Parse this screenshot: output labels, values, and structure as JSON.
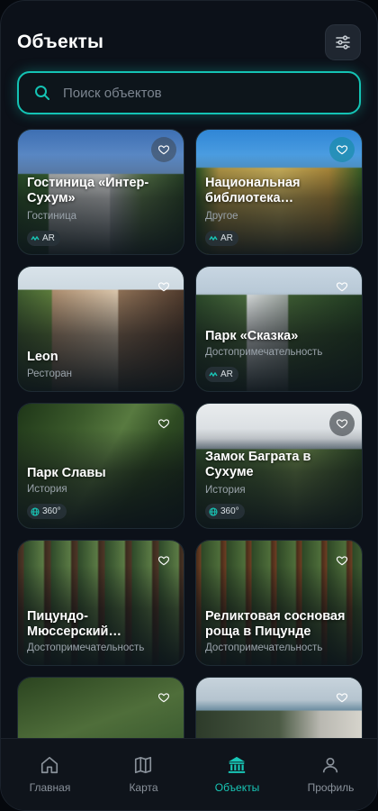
{
  "header": {
    "title": "Объекты",
    "filter_icon": "sliders-icon"
  },
  "search": {
    "placeholder": "Поиск объектов",
    "value": "",
    "icon": "search-icon"
  },
  "cards": [
    {
      "name": "Гостиница «Интер-Сухум»",
      "category": "Гостиница",
      "badge": "AR",
      "badge_icon": "ar-icon",
      "favorite": false
    },
    {
      "name": "Национальная библиотека…",
      "category": "Другое",
      "badge": "AR",
      "badge_icon": "ar-icon",
      "favorite": true
    },
    {
      "name": "Leon",
      "category": "Ресторан",
      "badge": "",
      "favorite": false
    },
    {
      "name": "Парк «Сказка»",
      "category": "Достопримечательность",
      "badge": "AR",
      "badge_icon": "ar-icon",
      "favorite": false
    },
    {
      "name": "Парк Славы",
      "category": "История",
      "badge": "360°",
      "badge_icon": "globe-icon",
      "favorite": false
    },
    {
      "name": "Замок Баграта в Сухуме",
      "category": "История",
      "badge": "360°",
      "badge_icon": "globe-icon",
      "favorite": true
    },
    {
      "name": "Пицундо-Мюссерский…",
      "category": "Достопримечательность",
      "badge": "",
      "favorite": false
    },
    {
      "name": "Реликтовая сосновая роща в Пицунде",
      "category": "Достопримечательность",
      "badge": "",
      "favorite": false
    },
    {
      "name": "",
      "category": "",
      "badge": "",
      "favorite": false
    },
    {
      "name": "",
      "category": "",
      "badge": "",
      "favorite": false
    }
  ],
  "nav": [
    {
      "label": "Главная",
      "icon": "home-icon",
      "active": false
    },
    {
      "label": "Карта",
      "icon": "map-icon",
      "active": false
    },
    {
      "label": "Объекты",
      "icon": "museum-icon",
      "active": true
    },
    {
      "label": "Профиль",
      "icon": "user-icon",
      "active": false
    }
  ],
  "colors": {
    "accent": "#18c6b6",
    "background": "#0c1119",
    "nav_inactive": "#8a929b"
  }
}
